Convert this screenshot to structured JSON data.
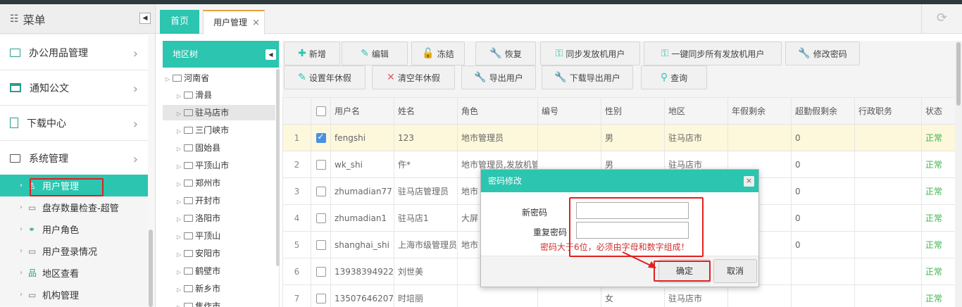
{
  "sidebar": {
    "title": "菜单",
    "collapse_glyph": "◀",
    "items": [
      {
        "label": "办公用品管理"
      },
      {
        "label": "通知公文"
      },
      {
        "label": "下载中心"
      },
      {
        "label": "系统管理"
      }
    ],
    "sub_items": [
      {
        "label": "用户管理"
      },
      {
        "label": "盘存数量检查-超管"
      },
      {
        "label": "用户角色"
      },
      {
        "label": "用户登录情况"
      },
      {
        "label": "地区查看"
      },
      {
        "label": "机构管理"
      }
    ]
  },
  "tabs": [
    {
      "label": "首页"
    },
    {
      "label": "用户管理",
      "close": "×"
    }
  ],
  "region_tree": {
    "title": "地区树",
    "root": "河南省",
    "nodes": [
      "滑县",
      "驻马店市",
      "三门峡市",
      "固始县",
      "平顶山市",
      "郑州市",
      "开封市",
      "洛阳市",
      "平顶山",
      "安阳市",
      "鹤壁市",
      "新乡市",
      "焦作市"
    ]
  },
  "toolbar": {
    "row1": [
      "新增",
      "编辑",
      "冻结",
      "恢复",
      "同步发放机用户",
      "一键同步所有发放机用户",
      "修改密码"
    ],
    "row2": [
      "设置年休假",
      "清空年休假",
      "导出用户",
      "下载导出用户",
      "查询"
    ]
  },
  "table": {
    "headers": [
      "用户名",
      "姓名",
      "角色",
      "编号",
      "性别",
      "地区",
      "年假剩余",
      "超勤假剩余",
      "行政职务",
      "状态"
    ],
    "rows": [
      {
        "no": "1",
        "checked": true,
        "username": "fengshi",
        "name": "123",
        "role": "地市管理员",
        "code": "",
        "gender": "男",
        "region": "驻马店市",
        "annual": "",
        "overtime": "0",
        "duty": "",
        "status": "正常"
      },
      {
        "no": "2",
        "checked": false,
        "username": "wk_shi",
        "name": "仵*",
        "role": "地市管理员,发放机管",
        "code": "",
        "gender": "男",
        "region": "驻马店市",
        "annual": "",
        "overtime": "0",
        "duty": "",
        "status": "正常"
      },
      {
        "no": "3",
        "checked": false,
        "username": "zhumadian77",
        "name": "驻马店管理员",
        "role": "地市",
        "code": "",
        "gender": "",
        "region": "",
        "annual": "",
        "overtime": "0",
        "duty": "",
        "status": "正常"
      },
      {
        "no": "4",
        "checked": false,
        "username": "zhumadian1",
        "name": "驻马店1",
        "role": "大屏",
        "code": "",
        "gender": "",
        "region": "",
        "annual": "",
        "overtime": "0",
        "duty": "",
        "status": "正常"
      },
      {
        "no": "5",
        "checked": false,
        "username": "shanghai_shi",
        "name": "上海市级管理员",
        "role": "地市",
        "code": "",
        "gender": "",
        "region": "",
        "annual": "",
        "overtime": "0",
        "duty": "",
        "status": "正常"
      },
      {
        "no": "6",
        "checked": false,
        "username": "13938394922",
        "name": "刘世美",
        "role": "",
        "code": "",
        "gender": "",
        "region": "",
        "annual": "",
        "overtime": "",
        "duty": "",
        "status": "正常"
      },
      {
        "no": "7",
        "checked": false,
        "username": "13507646207",
        "name": "时培丽",
        "role": "",
        "code": "",
        "gender": "女",
        "region": "驻马店市",
        "annual": "",
        "overtime": "",
        "duty": "",
        "status": "正常"
      }
    ]
  },
  "dialog": {
    "title": "密码修改",
    "close": "×",
    "new_password_label": "新密码",
    "confirm_password_label": "重复密码",
    "hint": "密码大于6位，必须由字母和数字组成！",
    "ok": "确定",
    "cancel": "取消"
  },
  "colors": {
    "accent": "#2bc5b0",
    "highlight_box": "#e02020",
    "status_ok": "#3bb54a",
    "hint": "#d32f2f"
  }
}
